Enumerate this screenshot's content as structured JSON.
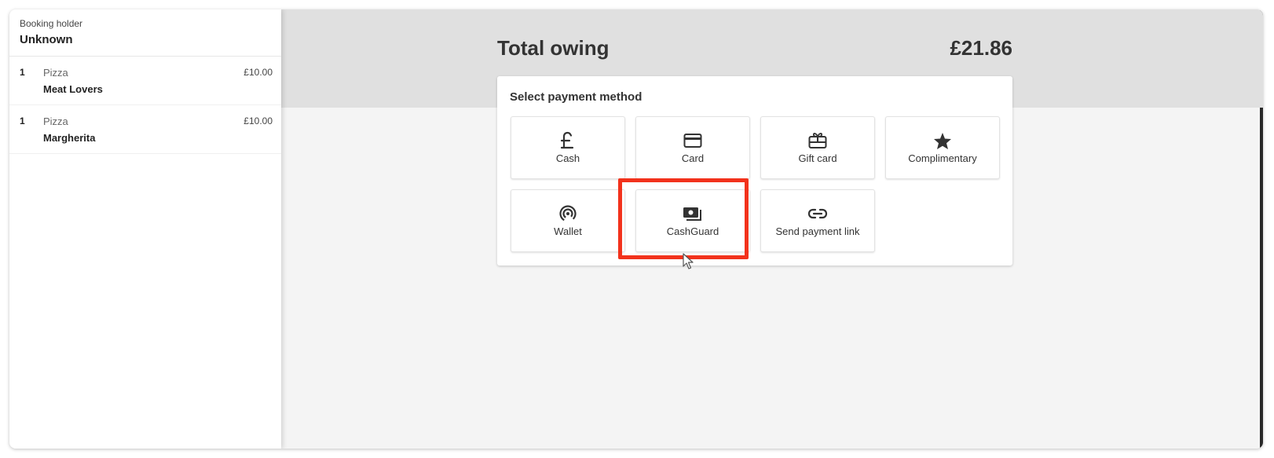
{
  "booking": {
    "holder_label": "Booking holder",
    "holder_name": "Unknown"
  },
  "order_items": [
    {
      "qty": "1",
      "category": "Pizza",
      "name": "Meat Lovers",
      "price": "£10.00"
    },
    {
      "qty": "1",
      "category": "Pizza",
      "name": "Margherita",
      "price": "£10.00"
    }
  ],
  "summary": {
    "total_label": "Total owing",
    "total_amount": "£21.86"
  },
  "payment": {
    "title": "Select payment method",
    "methods": [
      {
        "label": "Cash",
        "icon": "pound-icon"
      },
      {
        "label": "Card",
        "icon": "credit-card-icon"
      },
      {
        "label": "Gift card",
        "icon": "gift-card-icon"
      },
      {
        "label": "Complimentary",
        "icon": "star-icon"
      },
      {
        "label": "Wallet",
        "icon": "contactless-icon"
      },
      {
        "label": "CashGuard",
        "icon": "cash-drawer-icon"
      },
      {
        "label": "Send payment link",
        "icon": "link-icon"
      }
    ]
  },
  "colors": {
    "highlight": "#f2321c",
    "header_band": "#e0e0e0",
    "background": "#f4f4f4"
  }
}
